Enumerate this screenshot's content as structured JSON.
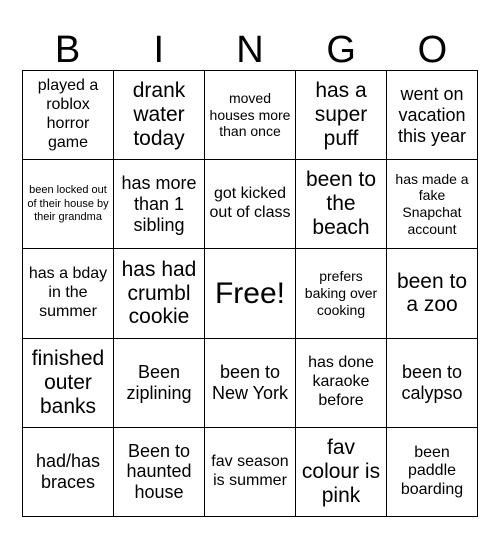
{
  "card": {
    "header_letters": [
      "B",
      "I",
      "N",
      "G",
      "O"
    ],
    "columns": 5,
    "rows": 5,
    "background_color": "#ffffff",
    "text_color": "#000000",
    "border_color": "#000000",
    "cells": [
      {
        "text": "played a roblox horror game",
        "size": "fs-md"
      },
      {
        "text": "drank water today",
        "size": "fs-xl"
      },
      {
        "text": "moved houses more than once",
        "size": "fs-sm"
      },
      {
        "text": "has a super puff",
        "size": "fs-xl"
      },
      {
        "text": "went on vacation this year",
        "size": "fs-lg"
      },
      {
        "text": "been locked out of their house by their grandma",
        "size": "fs-xs"
      },
      {
        "text": "has more than 1 sibling",
        "size": "fs-lg"
      },
      {
        "text": "got kicked out of class",
        "size": "fs-md"
      },
      {
        "text": "been to the beach",
        "size": "fs-xl"
      },
      {
        "text": "has made a fake Snapchat account",
        "size": "fs-sm"
      },
      {
        "text": "has a bday in the summer",
        "size": "fs-md"
      },
      {
        "text": "has had crumbl cookie",
        "size": "fs-xl"
      },
      {
        "text": "Free!",
        "size": "fs-free"
      },
      {
        "text": "prefers baking over cooking",
        "size": "fs-sm"
      },
      {
        "text": "been to a zoo",
        "size": "fs-xl"
      },
      {
        "text": "finished outer banks",
        "size": "fs-xl"
      },
      {
        "text": "Been ziplining",
        "size": "fs-lg"
      },
      {
        "text": "been to New York",
        "size": "fs-lg"
      },
      {
        "text": "has done karaoke before",
        "size": "fs-md"
      },
      {
        "text": "been to calypso",
        "size": "fs-lg"
      },
      {
        "text": "had/has braces",
        "size": "fs-lg"
      },
      {
        "text": "Been to haunted house",
        "size": "fs-lg"
      },
      {
        "text": "fav season is summer",
        "size": "fs-md"
      },
      {
        "text": "fav colour is pink",
        "size": "fs-xl"
      },
      {
        "text": "been paddle boarding",
        "size": "fs-md"
      }
    ]
  }
}
